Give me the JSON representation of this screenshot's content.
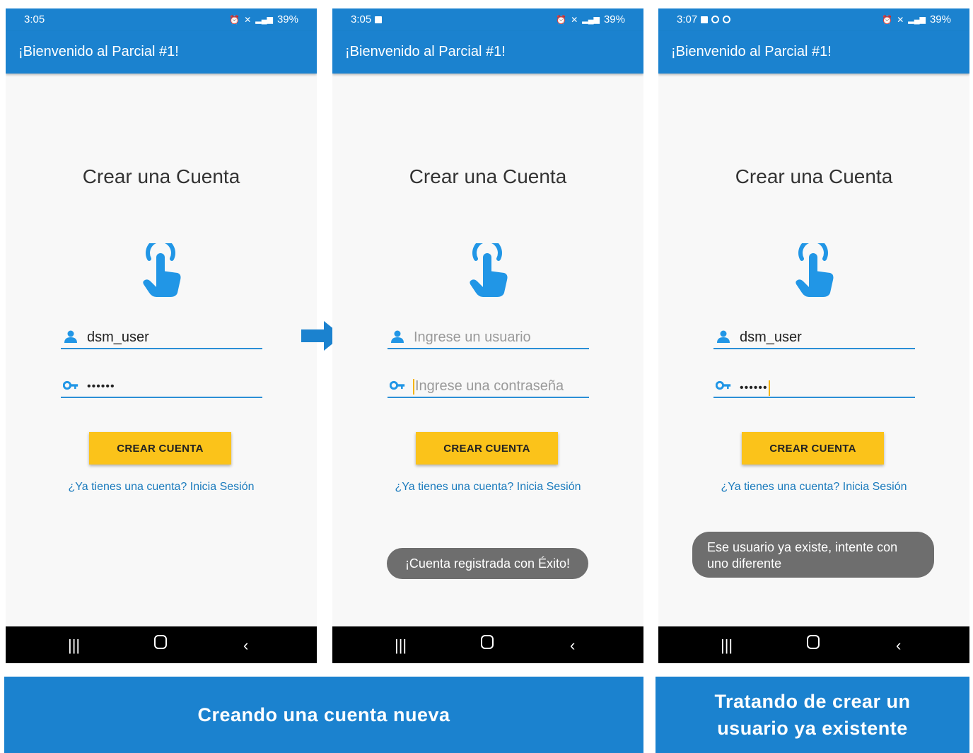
{
  "colors": {
    "primary": "#1b82cf",
    "accent": "#fbc31a",
    "toast": "#6e6e6e",
    "link": "#1b7bbd"
  },
  "screens": [
    {
      "status": {
        "time": "3:05",
        "battery": "39%"
      },
      "appbar_title": "¡Bienvenido al Parcial #1!",
      "heading": "Crear una Cuenta",
      "username_value": "dsm_user",
      "password_value": "••••••",
      "button": "CREAR CUENTA",
      "link": "¿Ya tienes una cuenta? Inicia Sesión"
    },
    {
      "status": {
        "time": "3:05",
        "battery": "39%"
      },
      "appbar_title": "¡Bienvenido al Parcial #1!",
      "heading": "Crear una Cuenta",
      "username_placeholder": "Ingrese un usuario",
      "password_placeholder": "Ingrese una contraseña",
      "button": "CREAR CUENTA",
      "link": "¿Ya tienes una cuenta? Inicia Sesión",
      "toast": "¡Cuenta registrada con Éxito!"
    },
    {
      "status": {
        "time": "3:07",
        "battery": "39%"
      },
      "appbar_title": "¡Bienvenido al Parcial #1!",
      "heading": "Crear una Cuenta",
      "username_value": "dsm_user",
      "password_value": "••••••",
      "button": "CREAR CUENTA",
      "link": "¿Ya tienes una cuenta? Inicia Sesión",
      "toast": "Ese usuario ya existe, intente con uno diferente"
    }
  ],
  "captions": {
    "left": "Creando una cuenta nueva",
    "right": "Tratando de crear un usuario ya existente"
  },
  "icons": [
    "touch-hand-icon",
    "person-icon",
    "key-icon",
    "arrow-right-icon",
    "recents-icon",
    "home-icon",
    "back-icon"
  ]
}
